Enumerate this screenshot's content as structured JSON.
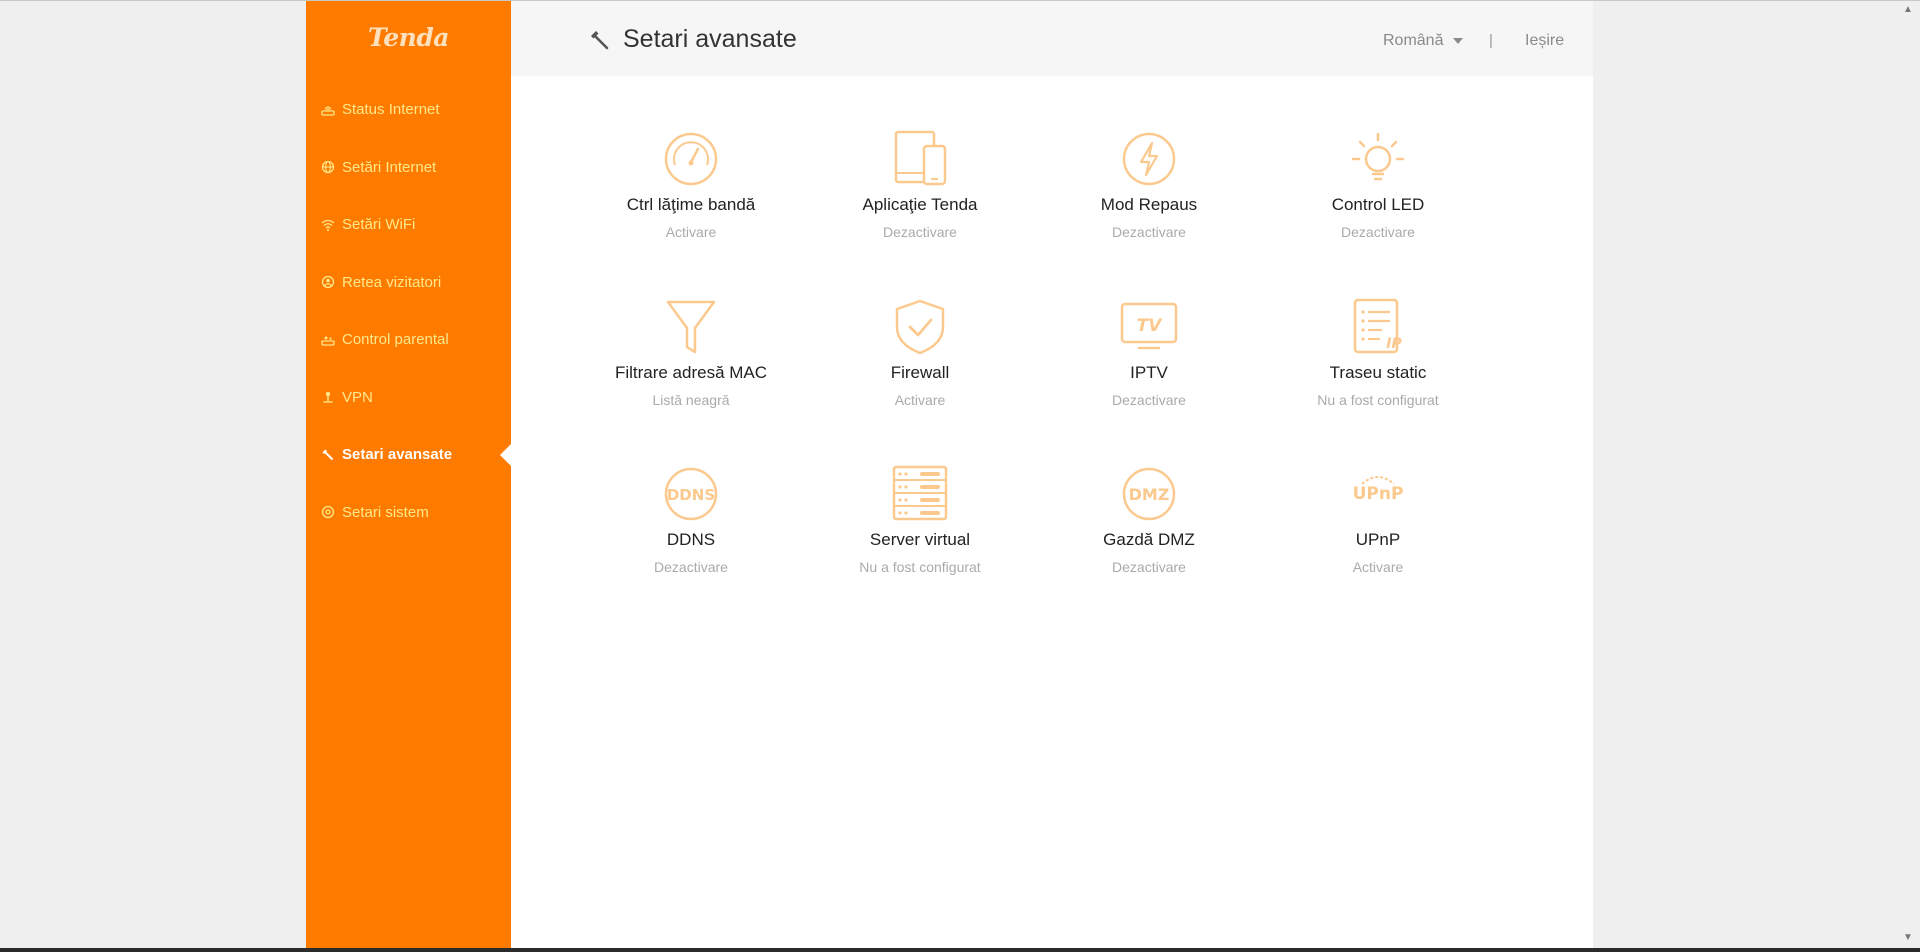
{
  "brand": {
    "logo_text": "Tenda"
  },
  "sidebar": {
    "items": [
      {
        "label": "Status Internet",
        "icon": "router-status-icon",
        "active": false
      },
      {
        "label": "Setări Internet",
        "icon": "globe-icon",
        "active": false
      },
      {
        "label": "Setări WiFi",
        "icon": "wifi-icon",
        "active": false
      },
      {
        "label": "Retea vizitatori",
        "icon": "guest-network-icon",
        "active": false
      },
      {
        "label": "Control parental",
        "icon": "parental-control-icon",
        "active": false
      },
      {
        "label": "VPN",
        "icon": "vpn-icon",
        "active": false
      },
      {
        "label": "Setari avansate",
        "icon": "wrench-icon",
        "active": true
      },
      {
        "label": "Setari sistem",
        "icon": "gear-icon",
        "active": false
      }
    ]
  },
  "header": {
    "title": "Setari avansate",
    "language": "Română",
    "divider": "|",
    "logout": "Ieșire"
  },
  "tiles": [
    {
      "name": "Ctrl lăţime bandă",
      "status": "Activare",
      "icon": "speedometer-icon"
    },
    {
      "name": "Aplicaţie Tenda",
      "status": "Dezactivare",
      "icon": "devices-icon"
    },
    {
      "name": "Mod Repaus",
      "status": "Dezactivare",
      "icon": "lightning-icon"
    },
    {
      "name": "Control LED",
      "status": "Dezactivare",
      "icon": "lightbulb-icon"
    },
    {
      "name": "Filtrare adresă MAC",
      "status": "Listă neagră",
      "icon": "filter-icon"
    },
    {
      "name": "Firewall",
      "status": "Activare",
      "icon": "shield-check-icon"
    },
    {
      "name": "IPTV",
      "status": "Dezactivare",
      "icon": "tv-icon",
      "icon_text": "TV"
    },
    {
      "name": "Traseu static",
      "status": "Nu a fost configurat",
      "icon": "route-list-icon",
      "icon_text": "IP"
    },
    {
      "name": "DDNS",
      "status": "Dezactivare",
      "icon": "ddns-icon",
      "icon_text": "DDNS"
    },
    {
      "name": "Server virtual",
      "status": "Nu a fost configurat",
      "icon": "server-icon"
    },
    {
      "name": "Gazdă DMZ",
      "status": "Dezactivare",
      "icon": "dmz-icon",
      "icon_text": "DMZ"
    },
    {
      "name": "UPnP",
      "status": "Activare",
      "icon": "upnp-icon",
      "icon_text": "UPnP"
    }
  ],
  "colors": {
    "sidebar_bg": "#ff7b00",
    "sidebar_text": "#ffe88a",
    "icon_stroke": "#fbc98d",
    "active_text": "#ffffff"
  }
}
